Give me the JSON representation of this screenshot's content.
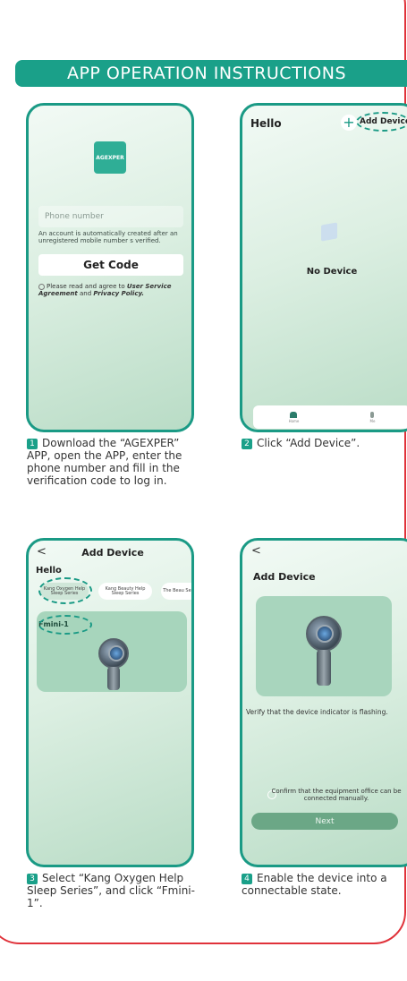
{
  "banner": {
    "title": "APP OPERATION INSTRUCTIONS"
  },
  "screen1": {
    "logo": "AGEXPER",
    "phone_placeholder": "Phone number",
    "note": "An account is automatically created after an unregistered mobile number s verified.",
    "button": "Get Code",
    "agree_prefix": "Please read and agree to",
    "agree_link1": "User Service Agreement",
    "agree_and": "and",
    "agree_link2": "Privacy Policy."
  },
  "screen2": {
    "greeting": "Hello",
    "add_button": "Add Device",
    "empty": "No Device",
    "tabs": [
      {
        "label": "Home"
      },
      {
        "label": "Me"
      }
    ]
  },
  "screen3": {
    "back": "<",
    "title": "Add Device",
    "greeting": "Hello",
    "categories": [
      {
        "label": "Kang Oxygen Help Sleep Series"
      },
      {
        "label": "Kang Beauty Help Sleep Series"
      },
      {
        "label": "The Beau Series"
      }
    ],
    "device": "Fmini-1"
  },
  "screen4": {
    "back": "<",
    "title": "Add Device",
    "verify": "Verify that the device indicator is flashing.",
    "confirm": "Confirm that the equipment office can be connected manually.",
    "next": "Next"
  },
  "steps": [
    {
      "num": "1",
      "text": "Download the “AGEXPER” APP, open the APP, enter the phone number and fill in the verification code to log in."
    },
    {
      "num": "2",
      "text": "Click “Add Device”."
    },
    {
      "num": "3",
      "text": "Select “Kang Oxygen Help Sleep Series”, and click “Fmini-1”."
    },
    {
      "num": "4",
      "text": "Enable the device into a connectable state."
    }
  ],
  "colors": {
    "accent": "#1aa089",
    "border": "#e0323a"
  }
}
